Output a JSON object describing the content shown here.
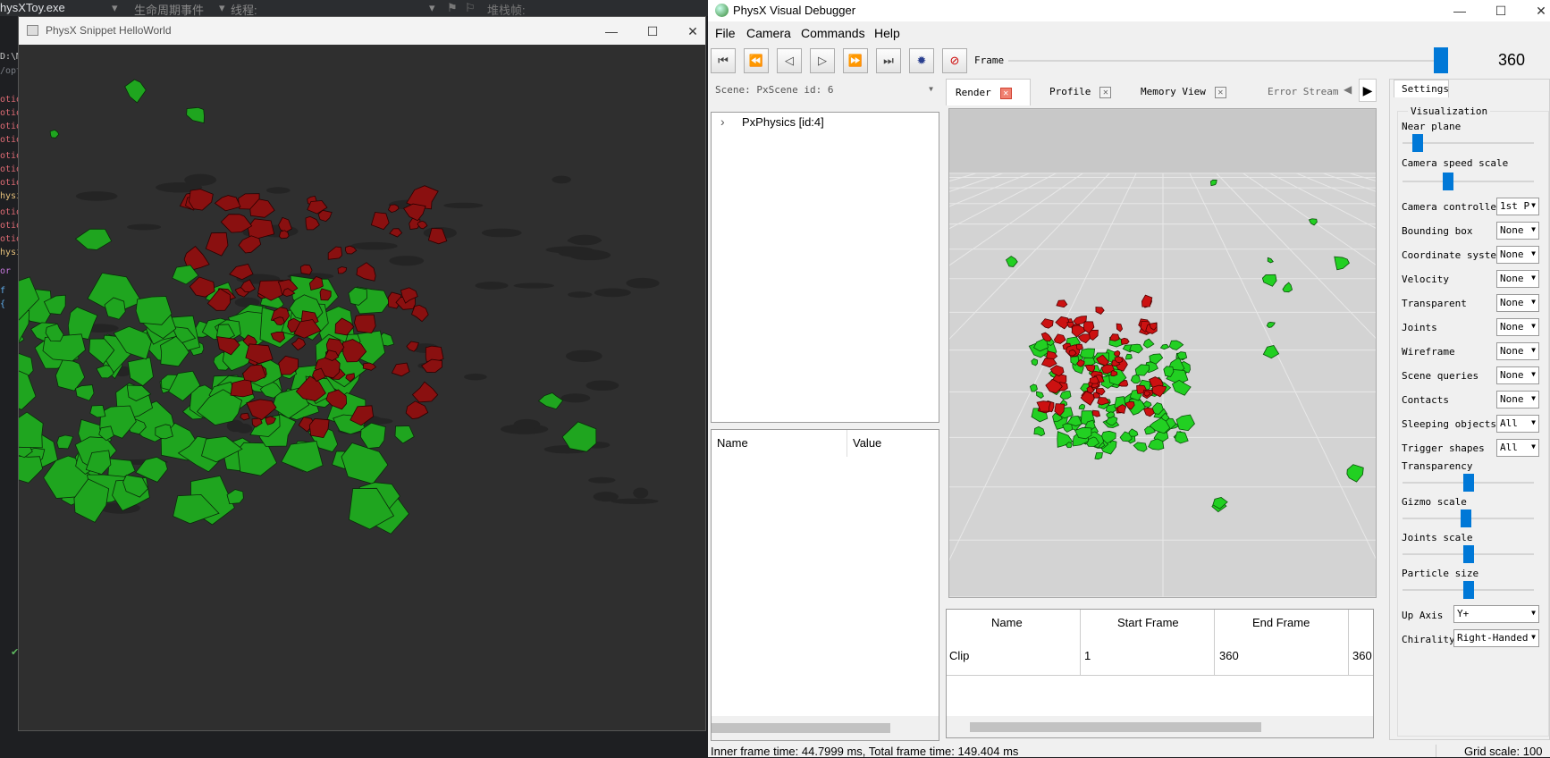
{
  "ide": {
    "topbar": {
      "exe": "hysXToy.exe",
      "lifecycle": "生命周期事件",
      "thread": "线程:",
      "stack_frame": "堆栈帧:"
    },
    "gutter_lines": [
      {
        "text": "D:\\M",
        "color": "#c9c9c9"
      },
      {
        "text": "/opt",
        "color": "#7a7e85"
      },
      {
        "text": "otio",
        "color": "#e06c75"
      },
      {
        "text": "otio",
        "color": "#e06c75"
      },
      {
        "text": "otio",
        "color": "#e06c75"
      },
      {
        "text": "otio",
        "color": "#e06c75"
      },
      {
        "text": "otio",
        "color": "#e06c75"
      },
      {
        "text": "otio",
        "color": "#e06c75"
      },
      {
        "text": "otio",
        "color": "#e06c75"
      },
      {
        "text": "hysi",
        "color": "#e5c07b"
      },
      {
        "text": "otio",
        "color": "#e06c75"
      },
      {
        "text": "otio",
        "color": "#e06c75"
      },
      {
        "text": "otio",
        "color": "#e06c75"
      },
      {
        "text": "hysi",
        "color": "#e5c07b"
      },
      {
        "text": "or (",
        "color": "#c678dd"
      },
      {
        "text": "f",
        "color": "#61afef"
      },
      {
        "text": "{",
        "color": "#61afef"
      }
    ],
    "close_glyph": "✕",
    "check_glyph": "✔"
  },
  "hello": {
    "title": "PhysX Snippet HelloWorld",
    "min": "—",
    "max": "☐",
    "close": "✕"
  },
  "pvd": {
    "title": "PhysX Visual Debugger",
    "min": "—",
    "max": "☐",
    "close": "✕",
    "menu": [
      "File",
      "Camera",
      "Commands",
      "Help"
    ],
    "frame_label": "Frame",
    "frame_value": "360",
    "frame_progress": 1.0,
    "scene_selector": "Scene: PxScene id: 6",
    "tree_root": "PxPhysics [id:4]",
    "props_headers": [
      "Name",
      "Value"
    ],
    "tabs": [
      "Render",
      "Profile",
      "Memory View",
      "Error Stream"
    ],
    "clip_table": {
      "headers": [
        "Name",
        "Start Frame",
        "End Frame",
        ""
      ],
      "rows": [
        [
          "Clip",
          "1",
          "360",
          "360"
        ]
      ]
    },
    "status_left": "Inner frame time: 44.7999 ms, Total frame time: 149.404 ms",
    "status_right": "Grid scale: 100",
    "settings": {
      "tab": "Settings",
      "group": "Visualization",
      "near_plane": {
        "label": "Near plane",
        "value": 0.08
      },
      "camera_speed": {
        "label": "Camera speed scale",
        "value": 0.33
      },
      "combos": [
        {
          "label": "Camera controller",
          "value": "1st P"
        },
        {
          "label": "Bounding box",
          "value": "None"
        },
        {
          "label": "Coordinate system",
          "value": "None"
        },
        {
          "label": "Velocity",
          "value": "None"
        },
        {
          "label": "Transparent",
          "value": "None"
        },
        {
          "label": "Joints",
          "value": "None"
        },
        {
          "label": "Wireframe",
          "value": "None"
        },
        {
          "label": "Scene queries",
          "value": "None"
        },
        {
          "label": "Contacts",
          "value": "None"
        },
        {
          "label": "Sleeping objects",
          "value": "All"
        },
        {
          "label": "Trigger shapes",
          "value": "All"
        }
      ],
      "sliders": [
        {
          "label": "Transparency",
          "value": 0.5
        },
        {
          "label": "Gizmo scale",
          "value": 0.48
        },
        {
          "label": "Joints scale",
          "value": 0.5
        },
        {
          "label": "Particle size",
          "value": 0.5
        }
      ],
      "up_axis": {
        "label": "Up Axis",
        "value": "Y+"
      },
      "chirality": {
        "label": "Chirality",
        "value": "Right-Handed"
      }
    }
  }
}
